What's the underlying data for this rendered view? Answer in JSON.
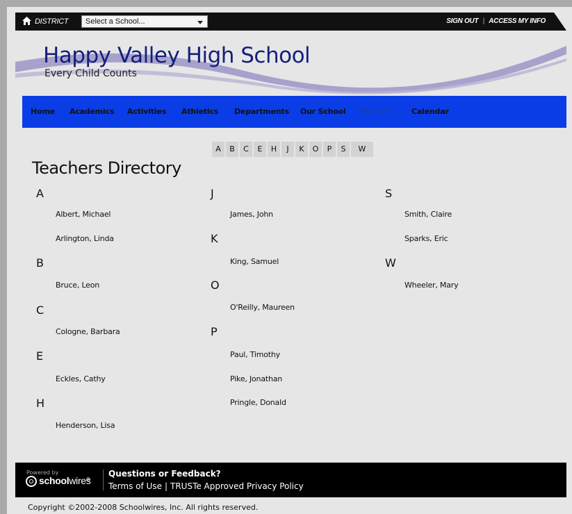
{
  "topbar": {
    "district_label": "DISTRICT",
    "school_select_value": "Select a School...",
    "sign_out": "SIGN OUT",
    "separator": "|",
    "access_info": "ACCESS MY INFO"
  },
  "header": {
    "school_name": "Happy Valley High School",
    "tagline": "Every Child Counts"
  },
  "nav": {
    "items": [
      {
        "label": "Home"
      },
      {
        "label": "Academics"
      },
      {
        "label": "Activities"
      },
      {
        "label": "Athletics"
      },
      {
        "label": "Departments"
      },
      {
        "label": "Our School"
      },
      {
        "label": "Teachers",
        "active": true
      },
      {
        "label": "Calendar"
      }
    ]
  },
  "alpha_index": [
    "A",
    "B",
    "C",
    "E",
    "H",
    "J",
    "K",
    "O",
    "P",
    "S",
    "W"
  ],
  "directory": {
    "title": "Teachers Directory",
    "groups": [
      {
        "letter": "A",
        "teachers": [
          "Albert, Michael",
          "Arlington, Linda"
        ]
      },
      {
        "letter": "B",
        "teachers": [
          "Bruce, Leon"
        ]
      },
      {
        "letter": "C",
        "teachers": [
          "Cologne, Barbara"
        ]
      },
      {
        "letter": "E",
        "teachers": [
          "Eckles, Cathy"
        ]
      },
      {
        "letter": "H",
        "teachers": [
          "Henderson, Lisa"
        ]
      },
      {
        "letter": "J",
        "teachers": [
          "James, John"
        ]
      },
      {
        "letter": "K",
        "teachers": [
          "King, Samuel"
        ]
      },
      {
        "letter": "O",
        "teachers": [
          "O'Reilly, Maureen"
        ]
      },
      {
        "letter": "P",
        "teachers": [
          "Paul, Timothy",
          "Pike, Jonathan",
          "Pringle, Donald"
        ]
      },
      {
        "letter": "S",
        "teachers": [
          "Smith, Claire",
          "Sparks, Eric"
        ]
      },
      {
        "letter": "W",
        "teachers": [
          "Wheeler, Mary"
        ]
      }
    ]
  },
  "footer": {
    "powered_by": "Powered by",
    "logo_bold": "school",
    "logo_thin": "wires",
    "logo_reg": "®",
    "feedback": "Questions or Feedback?",
    "terms": "Terms of Use",
    "separator": "|",
    "truste": "TRUSTe Approved Privacy Policy",
    "copyright": "Copyright ©2002-2008 Schoolwires, Inc. All rights reserved."
  },
  "colors": {
    "nav_bg": "#0a3de6",
    "school_name": "#141f7a",
    "topbar_bg": "#111111",
    "footer_bg": "#000000",
    "page_bg": "#e6e6e6"
  }
}
